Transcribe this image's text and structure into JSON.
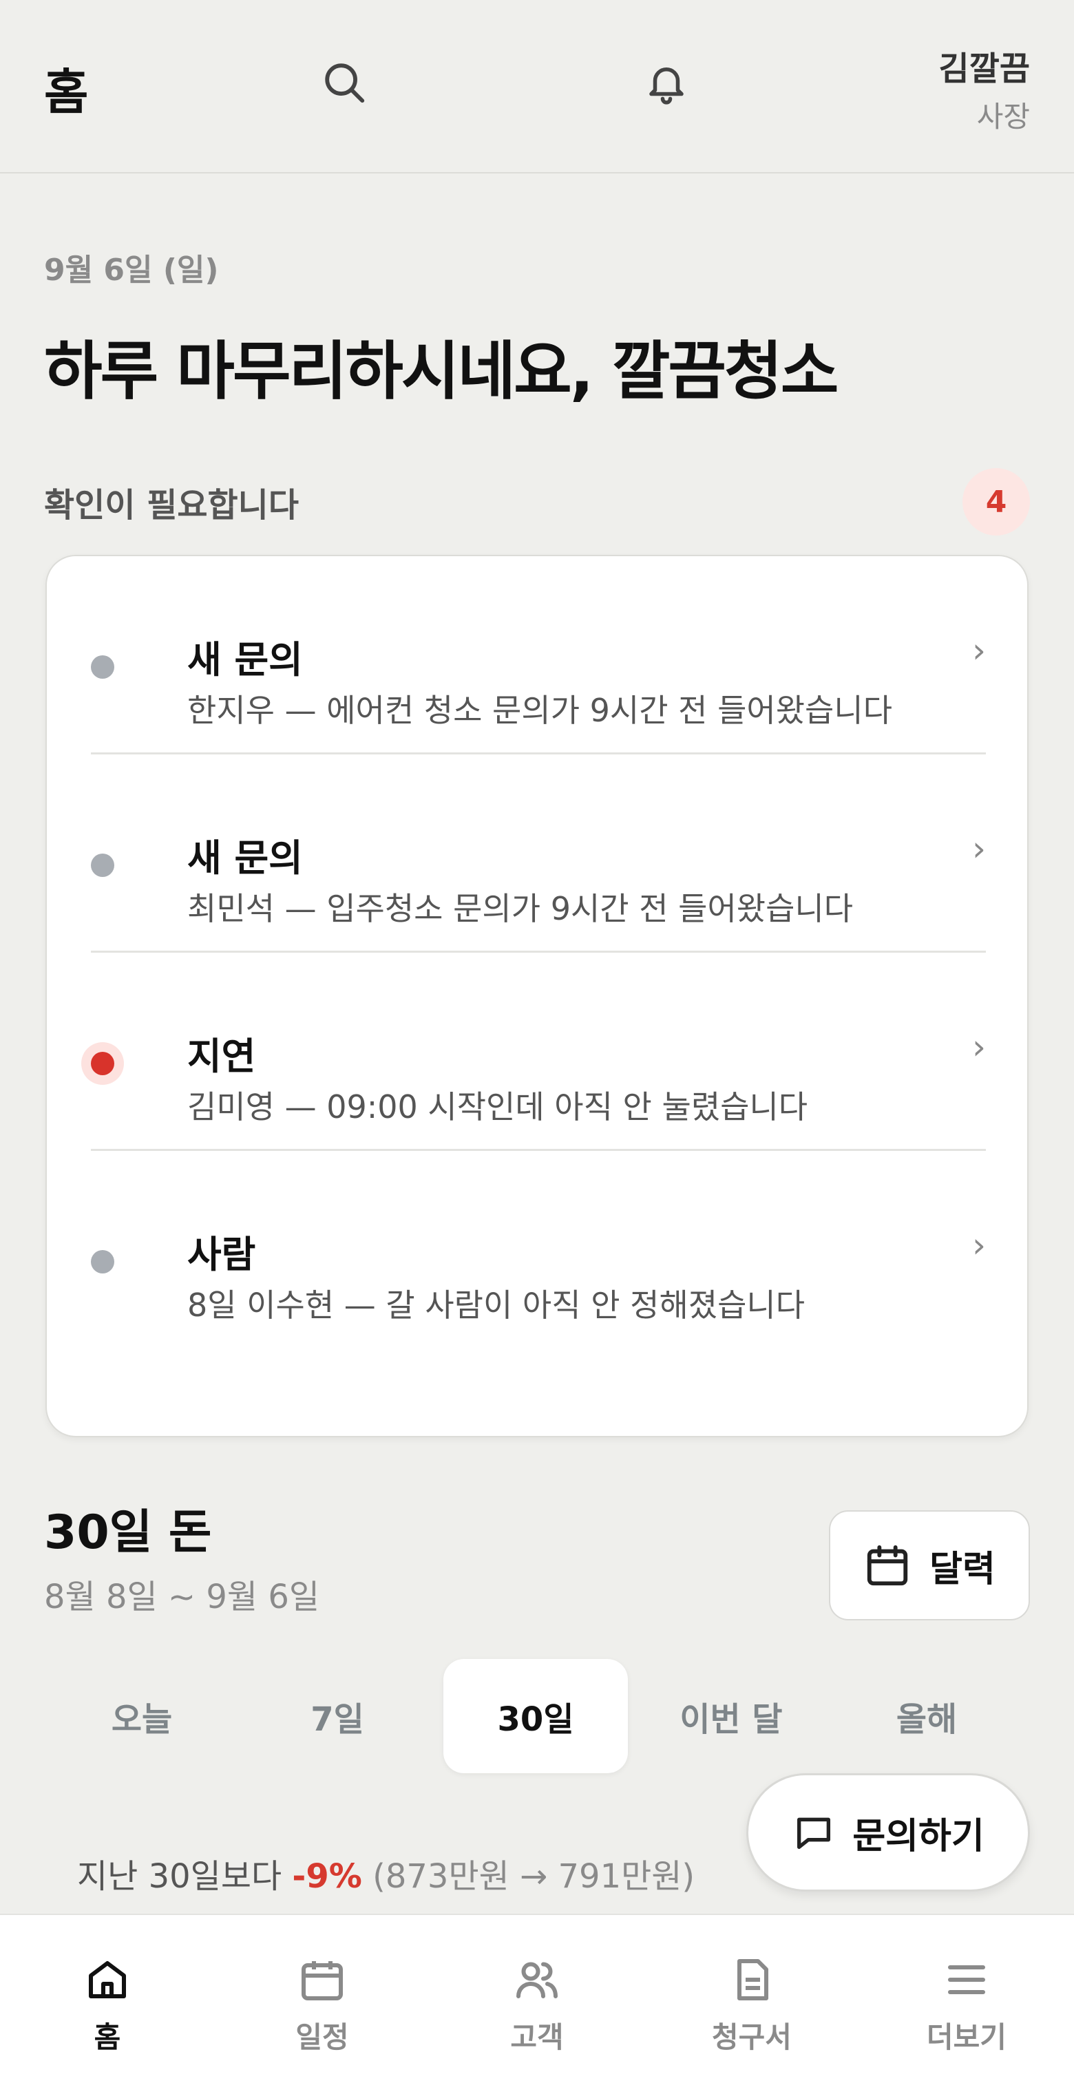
{
  "header": {
    "title": "홈",
    "user_name": "김깔끔",
    "user_role": "사장"
  },
  "date": "9월 6일 (일)",
  "greeting": "하루 마무리하시네요, 깔끔청소",
  "attention": {
    "title": "확인이 필요합니다",
    "count": "4",
    "items": [
      {
        "title": "새 문의",
        "desc": "한지우 — 에어컨 청소 문의가 9시간 전 들어왔습니다",
        "status": "normal"
      },
      {
        "title": "새 문의",
        "desc": "최민석 — 입주청소 문의가 9시간 전 들어왔습니다",
        "status": "normal"
      },
      {
        "title": "지연",
        "desc": "김미영 — 09:00 시작인데 아직 안 눌렸습니다",
        "status": "alert"
      },
      {
        "title": "사람",
        "desc": "8일 이수현 — 갈 사람이 아직 안 정해졌습니다",
        "status": "normal"
      }
    ]
  },
  "money": {
    "title": "30일 돈",
    "range": "8월 8일 ~ 9월 6일",
    "calendar_label": "달력",
    "tabs": [
      "오늘",
      "7일",
      "30일",
      "이번 달",
      "올해"
    ],
    "active_tab": "30일",
    "comparison_prefix": "지난 30일보다",
    "comparison_change": "-9%",
    "comparison_detail": "(873만원 → 791만원)"
  },
  "fab_label": "문의하기",
  "bottom_nav": [
    {
      "label": "홈",
      "icon": "home-icon",
      "active": true
    },
    {
      "label": "일정",
      "icon": "calendar-icon",
      "active": false
    },
    {
      "label": "고객",
      "icon": "users-icon",
      "active": false
    },
    {
      "label": "청구서",
      "icon": "document-icon",
      "active": false
    },
    {
      "label": "더보기",
      "icon": "menu-icon",
      "active": false
    }
  ],
  "colors": {
    "background": "#efefec",
    "alert": "#d8332b",
    "muted": "#8a8a8a"
  }
}
